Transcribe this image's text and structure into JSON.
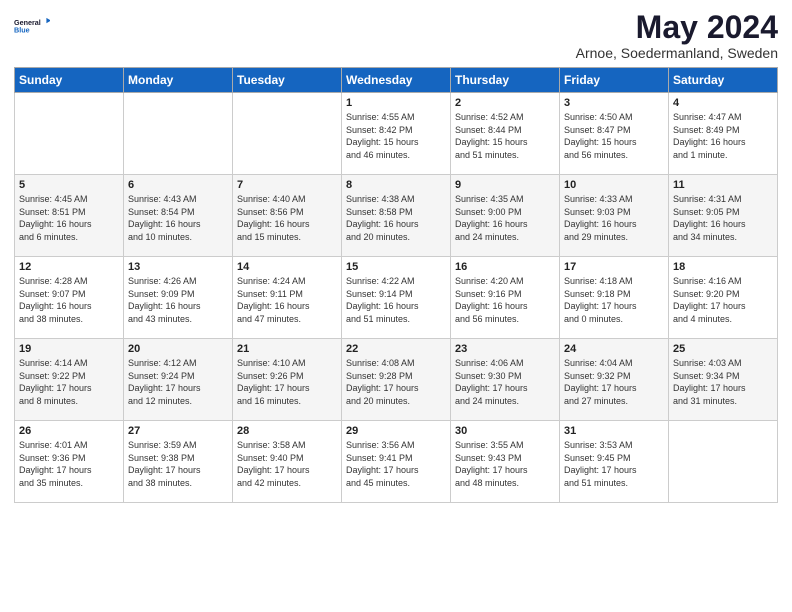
{
  "logo": {
    "line1": "General",
    "line2": "Blue"
  },
  "title": "May 2024",
  "subtitle": "Arnoe, Soedermanland, Sweden",
  "days_of_week": [
    "Sunday",
    "Monday",
    "Tuesday",
    "Wednesday",
    "Thursday",
    "Friday",
    "Saturday"
  ],
  "weeks": [
    [
      {
        "day": "",
        "info": ""
      },
      {
        "day": "",
        "info": ""
      },
      {
        "day": "",
        "info": ""
      },
      {
        "day": "1",
        "info": "Sunrise: 4:55 AM\nSunset: 8:42 PM\nDaylight: 15 hours\nand 46 minutes."
      },
      {
        "day": "2",
        "info": "Sunrise: 4:52 AM\nSunset: 8:44 PM\nDaylight: 15 hours\nand 51 minutes."
      },
      {
        "day": "3",
        "info": "Sunrise: 4:50 AM\nSunset: 8:47 PM\nDaylight: 15 hours\nand 56 minutes."
      },
      {
        "day": "4",
        "info": "Sunrise: 4:47 AM\nSunset: 8:49 PM\nDaylight: 16 hours\nand 1 minute."
      }
    ],
    [
      {
        "day": "5",
        "info": "Sunrise: 4:45 AM\nSunset: 8:51 PM\nDaylight: 16 hours\nand 6 minutes."
      },
      {
        "day": "6",
        "info": "Sunrise: 4:43 AM\nSunset: 8:54 PM\nDaylight: 16 hours\nand 10 minutes."
      },
      {
        "day": "7",
        "info": "Sunrise: 4:40 AM\nSunset: 8:56 PM\nDaylight: 16 hours\nand 15 minutes."
      },
      {
        "day": "8",
        "info": "Sunrise: 4:38 AM\nSunset: 8:58 PM\nDaylight: 16 hours\nand 20 minutes."
      },
      {
        "day": "9",
        "info": "Sunrise: 4:35 AM\nSunset: 9:00 PM\nDaylight: 16 hours\nand 24 minutes."
      },
      {
        "day": "10",
        "info": "Sunrise: 4:33 AM\nSunset: 9:03 PM\nDaylight: 16 hours\nand 29 minutes."
      },
      {
        "day": "11",
        "info": "Sunrise: 4:31 AM\nSunset: 9:05 PM\nDaylight: 16 hours\nand 34 minutes."
      }
    ],
    [
      {
        "day": "12",
        "info": "Sunrise: 4:28 AM\nSunset: 9:07 PM\nDaylight: 16 hours\nand 38 minutes."
      },
      {
        "day": "13",
        "info": "Sunrise: 4:26 AM\nSunset: 9:09 PM\nDaylight: 16 hours\nand 43 minutes."
      },
      {
        "day": "14",
        "info": "Sunrise: 4:24 AM\nSunset: 9:11 PM\nDaylight: 16 hours\nand 47 minutes."
      },
      {
        "day": "15",
        "info": "Sunrise: 4:22 AM\nSunset: 9:14 PM\nDaylight: 16 hours\nand 51 minutes."
      },
      {
        "day": "16",
        "info": "Sunrise: 4:20 AM\nSunset: 9:16 PM\nDaylight: 16 hours\nand 56 minutes."
      },
      {
        "day": "17",
        "info": "Sunrise: 4:18 AM\nSunset: 9:18 PM\nDaylight: 17 hours\nand 0 minutes."
      },
      {
        "day": "18",
        "info": "Sunrise: 4:16 AM\nSunset: 9:20 PM\nDaylight: 17 hours\nand 4 minutes."
      }
    ],
    [
      {
        "day": "19",
        "info": "Sunrise: 4:14 AM\nSunset: 9:22 PM\nDaylight: 17 hours\nand 8 minutes."
      },
      {
        "day": "20",
        "info": "Sunrise: 4:12 AM\nSunset: 9:24 PM\nDaylight: 17 hours\nand 12 minutes."
      },
      {
        "day": "21",
        "info": "Sunrise: 4:10 AM\nSunset: 9:26 PM\nDaylight: 17 hours\nand 16 minutes."
      },
      {
        "day": "22",
        "info": "Sunrise: 4:08 AM\nSunset: 9:28 PM\nDaylight: 17 hours\nand 20 minutes."
      },
      {
        "day": "23",
        "info": "Sunrise: 4:06 AM\nSunset: 9:30 PM\nDaylight: 17 hours\nand 24 minutes."
      },
      {
        "day": "24",
        "info": "Sunrise: 4:04 AM\nSunset: 9:32 PM\nDaylight: 17 hours\nand 27 minutes."
      },
      {
        "day": "25",
        "info": "Sunrise: 4:03 AM\nSunset: 9:34 PM\nDaylight: 17 hours\nand 31 minutes."
      }
    ],
    [
      {
        "day": "26",
        "info": "Sunrise: 4:01 AM\nSunset: 9:36 PM\nDaylight: 17 hours\nand 35 minutes."
      },
      {
        "day": "27",
        "info": "Sunrise: 3:59 AM\nSunset: 9:38 PM\nDaylight: 17 hours\nand 38 minutes."
      },
      {
        "day": "28",
        "info": "Sunrise: 3:58 AM\nSunset: 9:40 PM\nDaylight: 17 hours\nand 42 minutes."
      },
      {
        "day": "29",
        "info": "Sunrise: 3:56 AM\nSunset: 9:41 PM\nDaylight: 17 hours\nand 45 minutes."
      },
      {
        "day": "30",
        "info": "Sunrise: 3:55 AM\nSunset: 9:43 PM\nDaylight: 17 hours\nand 48 minutes."
      },
      {
        "day": "31",
        "info": "Sunrise: 3:53 AM\nSunset: 9:45 PM\nDaylight: 17 hours\nand 51 minutes."
      },
      {
        "day": "",
        "info": ""
      }
    ]
  ]
}
